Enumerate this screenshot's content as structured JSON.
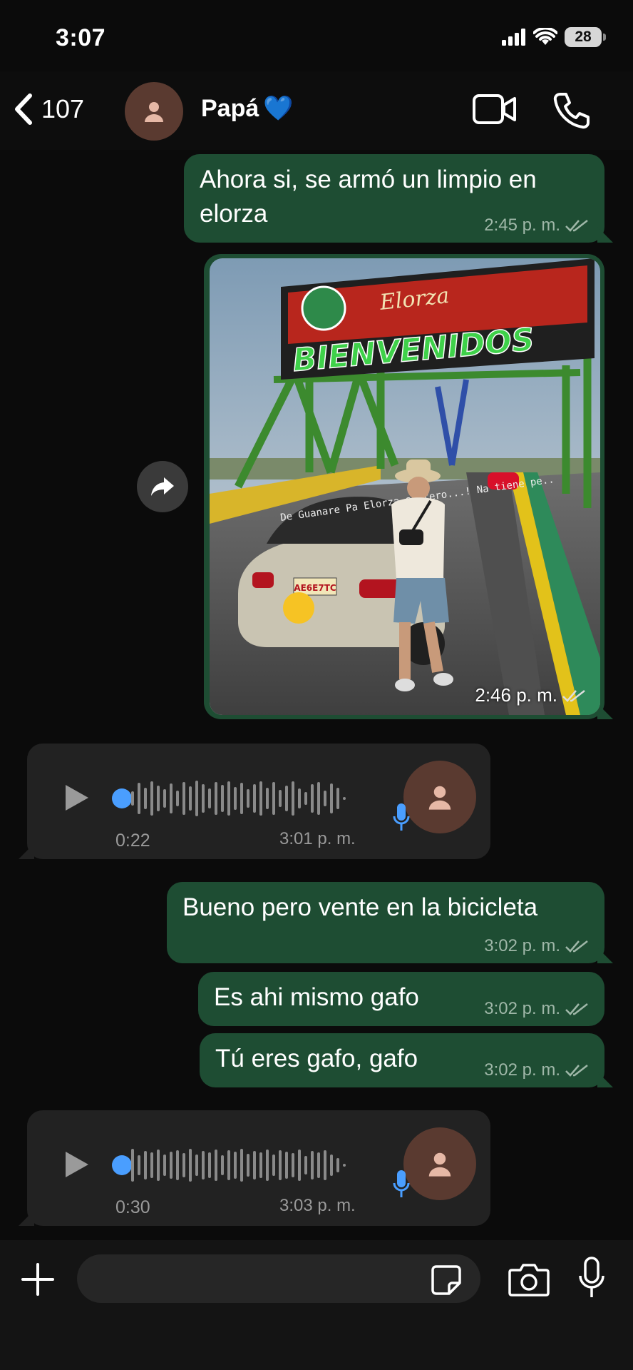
{
  "status_bar": {
    "time": "3:07",
    "battery": "28"
  },
  "header": {
    "back_count": "107",
    "contact_name": "Papá",
    "contact_emoji": "💙"
  },
  "messages": [
    {
      "type": "text",
      "direction": "out",
      "text": "Ahora si, se armó un limpio en elorza",
      "time": "2:45 p. m."
    },
    {
      "type": "image",
      "direction": "out",
      "time": "2:46 p. m.",
      "image": {
        "banner_title": "BIENVENIDOS",
        "banner_town": "Elorza",
        "windshield_text": "De Guanare Pa Elorza soltero...! Na tiene pe..",
        "plate": "AE6E7TC"
      }
    },
    {
      "type": "voice",
      "direction": "in",
      "duration": "0:22",
      "time": "3:01 p. m."
    },
    {
      "type": "text",
      "direction": "out",
      "text": "Bueno pero vente en la bicicleta",
      "time": "3:02 p. m."
    },
    {
      "type": "text",
      "direction": "out",
      "text": "Es ahi mismo gafo",
      "time": "3:02 p. m."
    },
    {
      "type": "text",
      "direction": "out",
      "text": "Tú eres gafo, gafo",
      "time": "3:02 p. m."
    },
    {
      "type": "voice",
      "direction": "in",
      "duration": "0:30",
      "time": "3:03 p. m."
    }
  ],
  "colors": {
    "outgoing": "#1e4d33",
    "incoming": "#222222",
    "accent": "#4a9eff"
  },
  "icons": [
    "back-icon",
    "video-icon",
    "phone-icon",
    "forward-icon",
    "play-icon",
    "mic-icon",
    "plus-icon",
    "sticker-icon",
    "camera-icon"
  ]
}
